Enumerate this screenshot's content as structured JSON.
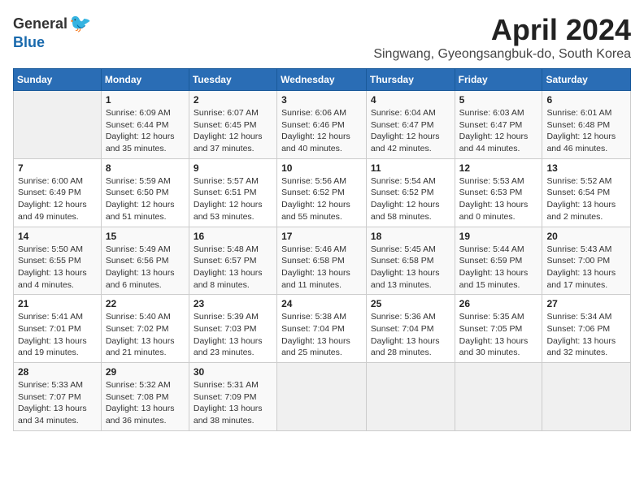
{
  "logo": {
    "general": "General",
    "blue": "Blue"
  },
  "title": {
    "month": "April 2024",
    "location": "Singwang, Gyeongsangbuk-do, South Korea"
  },
  "calendar": {
    "headers": [
      "Sunday",
      "Monday",
      "Tuesday",
      "Wednesday",
      "Thursday",
      "Friday",
      "Saturday"
    ],
    "weeks": [
      [
        {
          "day": "",
          "info": ""
        },
        {
          "day": "1",
          "info": "Sunrise: 6:09 AM\nSunset: 6:44 PM\nDaylight: 12 hours\nand 35 minutes."
        },
        {
          "day": "2",
          "info": "Sunrise: 6:07 AM\nSunset: 6:45 PM\nDaylight: 12 hours\nand 37 minutes."
        },
        {
          "day": "3",
          "info": "Sunrise: 6:06 AM\nSunset: 6:46 PM\nDaylight: 12 hours\nand 40 minutes."
        },
        {
          "day": "4",
          "info": "Sunrise: 6:04 AM\nSunset: 6:47 PM\nDaylight: 12 hours\nand 42 minutes."
        },
        {
          "day": "5",
          "info": "Sunrise: 6:03 AM\nSunset: 6:47 PM\nDaylight: 12 hours\nand 44 minutes."
        },
        {
          "day": "6",
          "info": "Sunrise: 6:01 AM\nSunset: 6:48 PM\nDaylight: 12 hours\nand 46 minutes."
        }
      ],
      [
        {
          "day": "7",
          "info": "Sunrise: 6:00 AM\nSunset: 6:49 PM\nDaylight: 12 hours\nand 49 minutes."
        },
        {
          "day": "8",
          "info": "Sunrise: 5:59 AM\nSunset: 6:50 PM\nDaylight: 12 hours\nand 51 minutes."
        },
        {
          "day": "9",
          "info": "Sunrise: 5:57 AM\nSunset: 6:51 PM\nDaylight: 12 hours\nand 53 minutes."
        },
        {
          "day": "10",
          "info": "Sunrise: 5:56 AM\nSunset: 6:52 PM\nDaylight: 12 hours\nand 55 minutes."
        },
        {
          "day": "11",
          "info": "Sunrise: 5:54 AM\nSunset: 6:52 PM\nDaylight: 12 hours\nand 58 minutes."
        },
        {
          "day": "12",
          "info": "Sunrise: 5:53 AM\nSunset: 6:53 PM\nDaylight: 13 hours\nand 0 minutes."
        },
        {
          "day": "13",
          "info": "Sunrise: 5:52 AM\nSunset: 6:54 PM\nDaylight: 13 hours\nand 2 minutes."
        }
      ],
      [
        {
          "day": "14",
          "info": "Sunrise: 5:50 AM\nSunset: 6:55 PM\nDaylight: 13 hours\nand 4 minutes."
        },
        {
          "day": "15",
          "info": "Sunrise: 5:49 AM\nSunset: 6:56 PM\nDaylight: 13 hours\nand 6 minutes."
        },
        {
          "day": "16",
          "info": "Sunrise: 5:48 AM\nSunset: 6:57 PM\nDaylight: 13 hours\nand 8 minutes."
        },
        {
          "day": "17",
          "info": "Sunrise: 5:46 AM\nSunset: 6:58 PM\nDaylight: 13 hours\nand 11 minutes."
        },
        {
          "day": "18",
          "info": "Sunrise: 5:45 AM\nSunset: 6:58 PM\nDaylight: 13 hours\nand 13 minutes."
        },
        {
          "day": "19",
          "info": "Sunrise: 5:44 AM\nSunset: 6:59 PM\nDaylight: 13 hours\nand 15 minutes."
        },
        {
          "day": "20",
          "info": "Sunrise: 5:43 AM\nSunset: 7:00 PM\nDaylight: 13 hours\nand 17 minutes."
        }
      ],
      [
        {
          "day": "21",
          "info": "Sunrise: 5:41 AM\nSunset: 7:01 PM\nDaylight: 13 hours\nand 19 minutes."
        },
        {
          "day": "22",
          "info": "Sunrise: 5:40 AM\nSunset: 7:02 PM\nDaylight: 13 hours\nand 21 minutes."
        },
        {
          "day": "23",
          "info": "Sunrise: 5:39 AM\nSunset: 7:03 PM\nDaylight: 13 hours\nand 23 minutes."
        },
        {
          "day": "24",
          "info": "Sunrise: 5:38 AM\nSunset: 7:04 PM\nDaylight: 13 hours\nand 25 minutes."
        },
        {
          "day": "25",
          "info": "Sunrise: 5:36 AM\nSunset: 7:04 PM\nDaylight: 13 hours\nand 28 minutes."
        },
        {
          "day": "26",
          "info": "Sunrise: 5:35 AM\nSunset: 7:05 PM\nDaylight: 13 hours\nand 30 minutes."
        },
        {
          "day": "27",
          "info": "Sunrise: 5:34 AM\nSunset: 7:06 PM\nDaylight: 13 hours\nand 32 minutes."
        }
      ],
      [
        {
          "day": "28",
          "info": "Sunrise: 5:33 AM\nSunset: 7:07 PM\nDaylight: 13 hours\nand 34 minutes."
        },
        {
          "day": "29",
          "info": "Sunrise: 5:32 AM\nSunset: 7:08 PM\nDaylight: 13 hours\nand 36 minutes."
        },
        {
          "day": "30",
          "info": "Sunrise: 5:31 AM\nSunset: 7:09 PM\nDaylight: 13 hours\nand 38 minutes."
        },
        {
          "day": "",
          "info": ""
        },
        {
          "day": "",
          "info": ""
        },
        {
          "day": "",
          "info": ""
        },
        {
          "day": "",
          "info": ""
        }
      ]
    ]
  }
}
